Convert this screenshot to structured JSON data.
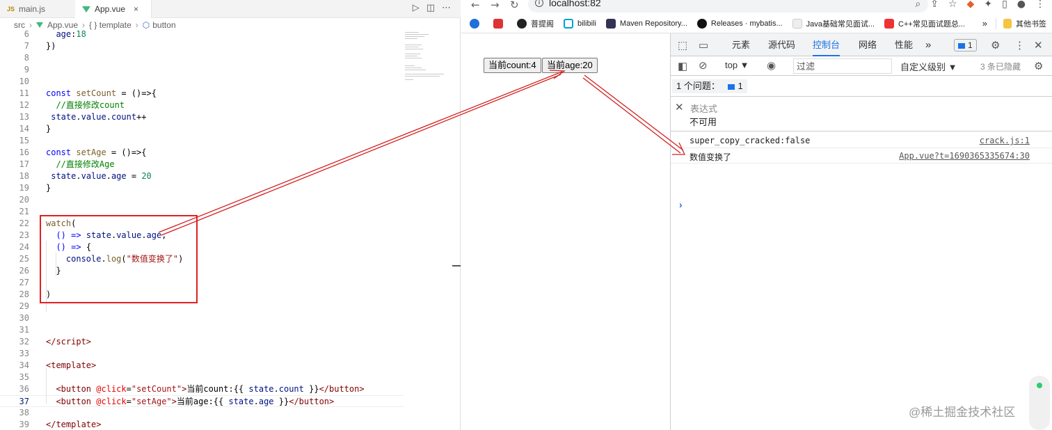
{
  "editor": {
    "tabs": [
      {
        "icon": "JS",
        "label": "main.js"
      },
      {
        "label": "App.vue",
        "close": "×"
      }
    ],
    "actions": [
      "▷",
      "◫",
      "⋯"
    ],
    "breadcrumb": {
      "src": "src",
      "file": "App.vue",
      "scope": "{ } template",
      "node": "button"
    },
    "line_numbers": [
      "6",
      "7",
      "8",
      "9",
      "10",
      "11",
      "12",
      "13",
      "14",
      "15",
      "16",
      "17",
      "18",
      "19",
      "20",
      "21",
      "22",
      "23",
      "24",
      "25",
      "26",
      "27",
      "28",
      "29",
      "30",
      "31",
      "32",
      "33",
      "34",
      "35",
      "36",
      "37",
      "38",
      "39"
    ]
  },
  "browser": {
    "nav": [
      "←",
      "→",
      "↻"
    ],
    "url": "localhost:82",
    "addr_icons": [
      "⌕",
      "⇪",
      "☆",
      "◆",
      "✦",
      "▯",
      "●",
      "⋮"
    ],
    "bookmarks": [
      {
        "label": "",
        "color": "#1e6fd9"
      },
      {
        "label": "",
        "color": "#d33"
      },
      {
        "label": "菩提阁",
        "color": "#222"
      },
      {
        "label": "bilibili",
        "color": "#00a1d6"
      },
      {
        "label": "Maven Repository...",
        "color": "#335"
      },
      {
        "label": "Releases · mybatis...",
        "color": "#111"
      },
      {
        "label": "Java基础常见面试...",
        "color": "#eee"
      },
      {
        "label": "C++常见面试题总...",
        "color": "#e33"
      }
    ],
    "bookmarks_more": "»",
    "other_bookmarks": "其他书签",
    "page": {
      "count_button": "当前count:4",
      "age_button": "当前age:20"
    }
  },
  "devtools": {
    "tabs": [
      "元素",
      "源代码",
      "控制台",
      "网络",
      "性能"
    ],
    "active_tab": "控制台",
    "more": "»",
    "issue_badge": "1",
    "context": "top ▼",
    "filter_placeholder": "过滤",
    "levels": "自定义级别 ▼",
    "hidden": "3 条已隐藏",
    "issues_label": "1 个问题：",
    "issues_count": "1",
    "expression_label": "表达式",
    "expression_value": "不可用",
    "logs": [
      {
        "message": "super_copy_cracked:false",
        "source": "crack.js:1"
      },
      {
        "message": "数值变换了",
        "source": "App.vue?t=1690365335674:30"
      }
    ],
    "prompt": "›"
  },
  "watermark": "@稀土掘金技术社区",
  "colors": {
    "highlight": "#e02020",
    "arrow": "#d42020",
    "accent": "#1a73e8"
  }
}
